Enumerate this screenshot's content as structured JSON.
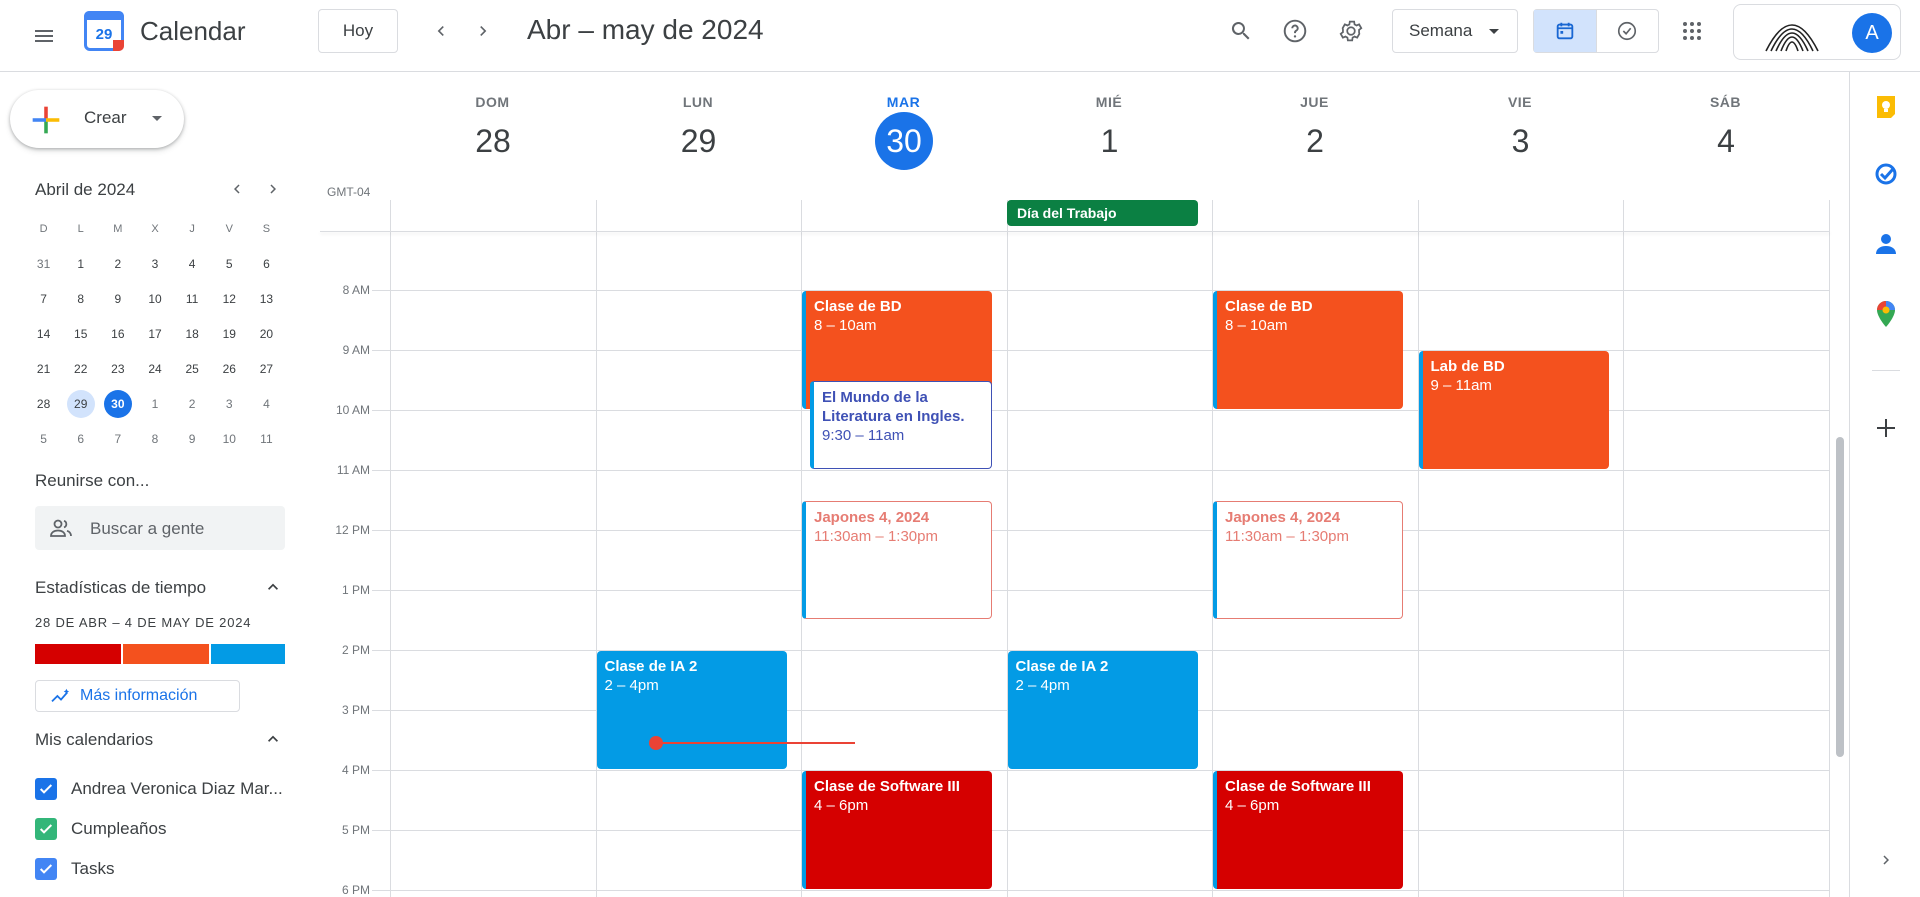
{
  "header": {
    "app_title": "Calendar",
    "logo_day": "29",
    "today_label": "Hoy",
    "date_range": "Abr – may de 2024",
    "view_label": "Semana",
    "avatar_letter": "A"
  },
  "sidebar": {
    "create_label": "Crear",
    "mini_calendar": {
      "title": "Abril de 2024",
      "weekdays": [
        "D",
        "L",
        "M",
        "X",
        "J",
        "V",
        "S"
      ],
      "weeks": [
        [
          "31",
          "1",
          "2",
          "3",
          "4",
          "5",
          "6"
        ],
        [
          "7",
          "8",
          "9",
          "10",
          "11",
          "12",
          "13"
        ],
        [
          "14",
          "15",
          "16",
          "17",
          "18",
          "19",
          "20"
        ],
        [
          "21",
          "22",
          "23",
          "24",
          "25",
          "26",
          "27"
        ],
        [
          "28",
          "29",
          "30",
          "1",
          "2",
          "3",
          "4"
        ],
        [
          "5",
          "6",
          "7",
          "8",
          "9",
          "10",
          "11"
        ]
      ],
      "selected_day": "29",
      "today": "30"
    },
    "meet_title": "Reunirse con...",
    "people_placeholder": "Buscar a gente",
    "stats": {
      "title": "Estadísticas de tiempo",
      "range": "28 DE ABR – 4 DE MAY DE 2024",
      "segments": [
        {
          "color": "#d50000",
          "share": 0.35
        },
        {
          "color": "#f4511e",
          "share": 0.35
        },
        {
          "color": "#039be5",
          "share": 0.3
        }
      ],
      "more_label": "Más información"
    },
    "my_calendars": {
      "title": "Mis calendarios",
      "items": [
        {
          "label": "Andrea Veronica Diaz Mar...",
          "color": "#1a73e8"
        },
        {
          "label": "Cumpleaños",
          "color": "#33b679"
        },
        {
          "label": "Tasks",
          "color": "#4285f4"
        }
      ]
    }
  },
  "calendar": {
    "timezone": "GMT-04",
    "days": [
      {
        "name": "DOM",
        "num": "28"
      },
      {
        "name": "LUN",
        "num": "29"
      },
      {
        "name": "MAR",
        "num": "30",
        "today": true
      },
      {
        "name": "MIÉ",
        "num": "1"
      },
      {
        "name": "JUE",
        "num": "2"
      },
      {
        "name": "VIE",
        "num": "3"
      },
      {
        "name": "SÁB",
        "num": "4"
      }
    ],
    "hours": [
      "8 AM",
      "9 AM",
      "10 AM",
      "11 AM",
      "12 PM",
      "1 PM",
      "2 PM",
      "3 PM",
      "4 PM",
      "5 PM",
      "6 PM"
    ],
    "all_day": {
      "title": "Día del Trabajo",
      "color": "#0b8043"
    },
    "events": [
      {
        "day": 2,
        "title": "Clase de BD",
        "time": "8 – 10am",
        "color": "#f4511e"
      },
      {
        "day": 2,
        "title": "El Mundo de la Literatura en Ingles.",
        "time": "9:30 – 11am",
        "color": "#3f51b5"
      },
      {
        "day": 2,
        "title": "Japones 4, 2024",
        "time": "11:30am – 1:30pm",
        "color": "#e67c73"
      },
      {
        "day": 2,
        "title": "Clase de Software III",
        "time": "4 – 6pm",
        "color": "#d50000"
      },
      {
        "day": 4,
        "title": "Clase de BD",
        "time": "8 – 10am",
        "color": "#f4511e"
      },
      {
        "day": 4,
        "title": "Japones 4, 2024",
        "time": "11:30am – 1:30pm",
        "color": "#e67c73"
      },
      {
        "day": 4,
        "title": "Clase de Software III",
        "time": "4 – 6pm",
        "color": "#d50000"
      },
      {
        "day": 5,
        "title": "Lab de BD",
        "time": "9 – 11am",
        "color": "#f4511e"
      },
      {
        "day": 1,
        "title": "Clase de IA 2",
        "time": "2 – 4pm",
        "color": "#039be5"
      },
      {
        "day": 3,
        "title": "Clase de IA 2",
        "time": "2 – 4pm",
        "color": "#039be5"
      }
    ]
  }
}
